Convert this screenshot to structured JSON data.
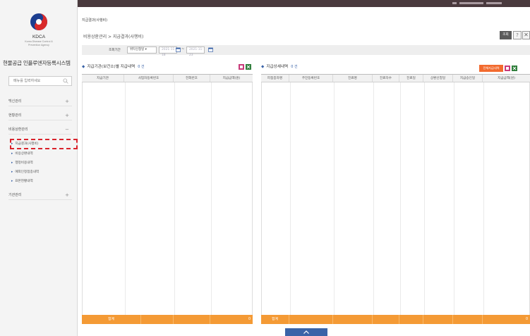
{
  "sidebar": {
    "logo_name": "KDCA",
    "logo_sub": [
      "Korea Disease Control &",
      "Prevention Agency"
    ],
    "system_title": "현물공급 인플루엔자등록시스템",
    "search_placeholder": "메뉴를 입력하세요",
    "menus": [
      {
        "label": "백신관리",
        "toggle": "+"
      },
      {
        "label": "현황관리",
        "toggle": "+"
      },
      {
        "label": "비용상환관리",
        "toggle": "−"
      }
    ],
    "submenus": [
      {
        "label": "지급결과(사행비)",
        "active": true
      },
      {
        "label": "비용상환내역"
      },
      {
        "label": "행정비용내역"
      },
      {
        "label": "예외인정접종내역"
      },
      {
        "label": "표본현황내역"
      }
    ],
    "last_menu": {
      "label": "기관관리",
      "toggle": "+"
    }
  },
  "header": {
    "window_title": "지급결과(사행비)",
    "breadcrumb": "비용상환관리 > 지급결과(사행비)",
    "search_button": "조회",
    "help_button": "?",
    "close_button": "✕"
  },
  "filter": {
    "label": "조회기간",
    "select_value": "위탁신청일 ▾",
    "date_from": "2021-11-18",
    "date_to": "2021-11-23",
    "separator": "~"
  },
  "left_panel": {
    "title": "지급기관(보건소)별 지급내역",
    "count": "0 건",
    "columns": [
      "지급기관",
      "사업자등록번호",
      "전화번호",
      "지급금액(원)"
    ],
    "footer": [
      "합계",
      "",
      "",
      "0"
    ]
  },
  "right_panel": {
    "title": "지급상세내역",
    "count": "0 건",
    "reissue_button": "전체지급내역",
    "columns": [
      "피접종자명",
      "주민등록번호",
      "진료명",
      "진료차수",
      "진료일",
      "상환신청일",
      "지급승인일",
      "지급금액(원)"
    ],
    "footer": [
      "합계",
      "",
      "",
      "",
      "",
      "",
      "",
      "0"
    ]
  },
  "colors": {
    "accent_orange": "#f49a35",
    "brand_blue": "#3a63a8",
    "highlight_red": "#d9232c",
    "topbar": "#4a3a3e"
  }
}
